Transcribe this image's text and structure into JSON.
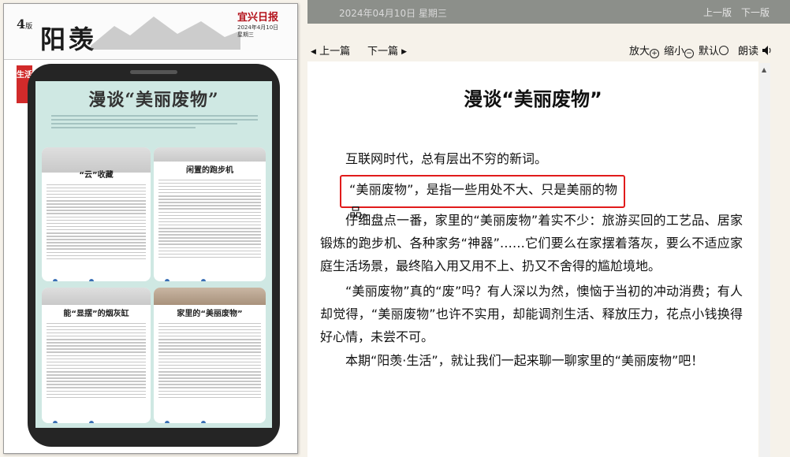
{
  "paper": {
    "page_number": "4",
    "page_suffix": "版",
    "column_name": "阳羡",
    "logo": "宜兴日报",
    "date_line": "2024年4月10日",
    "weekday": "星期三",
    "section_tag": "生活",
    "headline": "漫谈“美丽废物”",
    "cards": [
      {
        "title": "“云”收藏"
      },
      {
        "title": "闲置的跑步机"
      },
      {
        "title": "能“显摆”的烟灰缸"
      },
      {
        "title": "家里的“美丽废物”"
      }
    ]
  },
  "topbar": {
    "date": "2024年04月10日 星期三",
    "nav": "上一版　下一版"
  },
  "toolbar": {
    "prev": "上一篇",
    "next": "下一篇",
    "zoom_in": "放大",
    "zoom_out": "缩小",
    "default": "默认",
    "read": "朗读"
  },
  "article": {
    "title": "漫谈“美丽废物”",
    "p1": "互联网时代，总有层出不穷的新词。",
    "p2": "“美丽废物”，是指一些用处不大、只是美丽的物品。",
    "p3": "仔细盘点一番，家里的“美丽废物”着实不少：旅游买回的工艺品、居家锻炼的跑步机、各种家务“神器”……它们要么在家摆着落灰，要么不适应家庭生活场景，最终陷入用又用不上、扔又不舍得的尴尬境地。",
    "p4": "“美丽废物”真的“废”吗？有人深以为然，懊恼于当初的冲动消费；有人却觉得，“美丽废物”也许不实用，却能调剂生活、释放压力，花点小钱换得好心情，未尝不可。",
    "p5": "本期“阳羡·生活”，就让我们一起来聊一聊家里的“美丽废物”吧！"
  }
}
